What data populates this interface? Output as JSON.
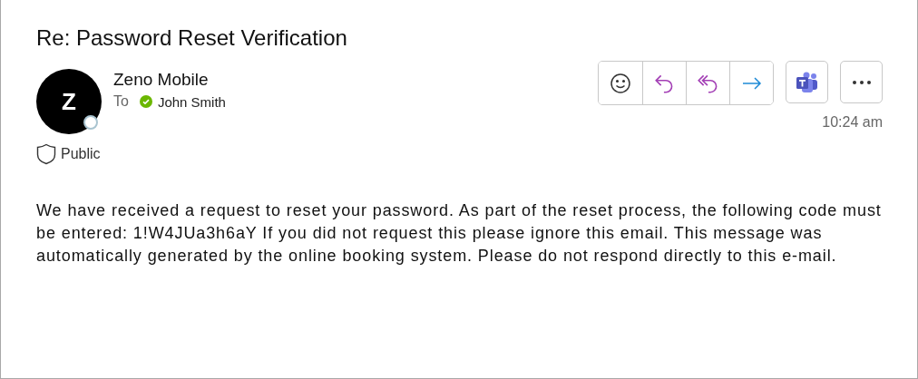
{
  "subject": "Re: Password Reset Verification",
  "sender": {
    "initial": "Z",
    "name": "Zeno Mobile",
    "to_label": "To",
    "recipient": "John Smith",
    "recipient_verified": true
  },
  "sensitivity": "Public",
  "time": "10:24 am",
  "actions": [
    {
      "kind": "emoji"
    },
    {
      "kind": "reply"
    },
    {
      "kind": "reply_all"
    },
    {
      "kind": "forward"
    }
  ],
  "body": "We have received a request to reset your password. As part of the reset process, the following code must be entered: 1!W4JUa3h6aY If you did not request this please ignore this email. This message was automatically generated by the online booking system. Please do not respond directly to this e-mail."
}
